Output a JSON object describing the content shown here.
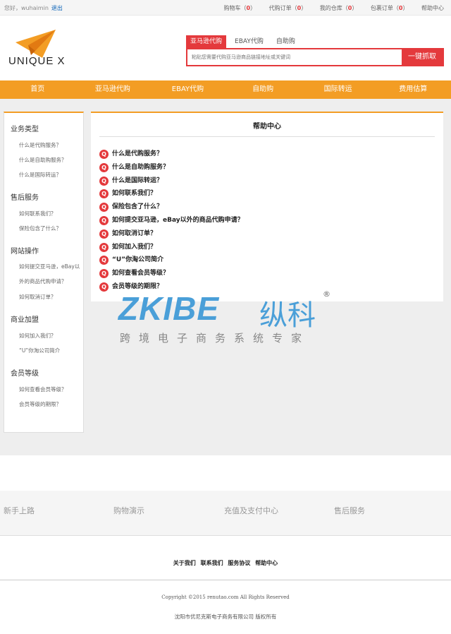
{
  "topbar": {
    "greeting": "您好，wuhaimin",
    "logout": "退出",
    "links": [
      {
        "label": "购物车",
        "count": "0"
      },
      {
        "label": "代购订单",
        "count": "0"
      },
      {
        "label": "我的仓库",
        "count": "0"
      },
      {
        "label": "包裹订单",
        "count": "0"
      }
    ],
    "help": "帮助中心"
  },
  "logo": {
    "text": "UNIQUE X"
  },
  "search": {
    "tabs": [
      "亚马逊代购",
      "EBAY代购",
      "自助购"
    ],
    "placeholder": "粘贴您需要代购亚马逊商品链接地址或关键词",
    "button": "一键抓取"
  },
  "nav": [
    "首页",
    "亚马逊代购",
    "EBAY代购",
    "自助购",
    "国际转运",
    "费用估算"
  ],
  "sidebar": [
    {
      "title": "业务类型",
      "links": [
        "什么是代购服务？",
        "什么是自助购服务？",
        "什么是国际转运？"
      ]
    },
    {
      "title": "售后服务",
      "links": [
        "如何联系我们？",
        "保险包含了什么？"
      ]
    },
    {
      "title": "网站操作",
      "links": [
        "如何提交亚马逊，eBay以外的商品代购申请？",
        "如何取消订单？"
      ]
    },
    {
      "title": "商业加盟",
      "links": [
        "如何加入我们？",
        "“U”你淘公司简介"
      ]
    },
    {
      "title": "会员等级",
      "links": [
        "如何查看会员等级？",
        "会员等级的期限？"
      ]
    }
  ],
  "content": {
    "title": "帮助中心",
    "faqs": [
      "什么是代购服务？",
      "什么是自助购服务？",
      "什么是国际转运？",
      "如何联系我们？",
      "保险包含了什么？",
      "如何提交亚马逊，eBay以外的商品代购申请？",
      "如何取消订单？",
      "如何加入我们？",
      "“U”你淘公司简介",
      "如何查看会员等级？",
      "会员等级的期限？"
    ]
  },
  "watermark": {
    "main": "ZKIBE",
    "cn": "纵科",
    "sub": "跨境电子商务系统专家",
    "reg": "®"
  },
  "footer": {
    "columns": [
      "新手上路",
      "购物演示",
      "充值及支付中心",
      "售后服务"
    ],
    "bottom_links": [
      "关于我们",
      "联系我们",
      "服务协议",
      "帮助中心"
    ],
    "copyright": "Copyright ©2015 renutao.com All Rights Reserved",
    "company": "沈阳市优尼克斯电子商务有限公司 版权所有"
  },
  "colors": {
    "accent": "#e4393c",
    "nav": "#f39d24"
  }
}
